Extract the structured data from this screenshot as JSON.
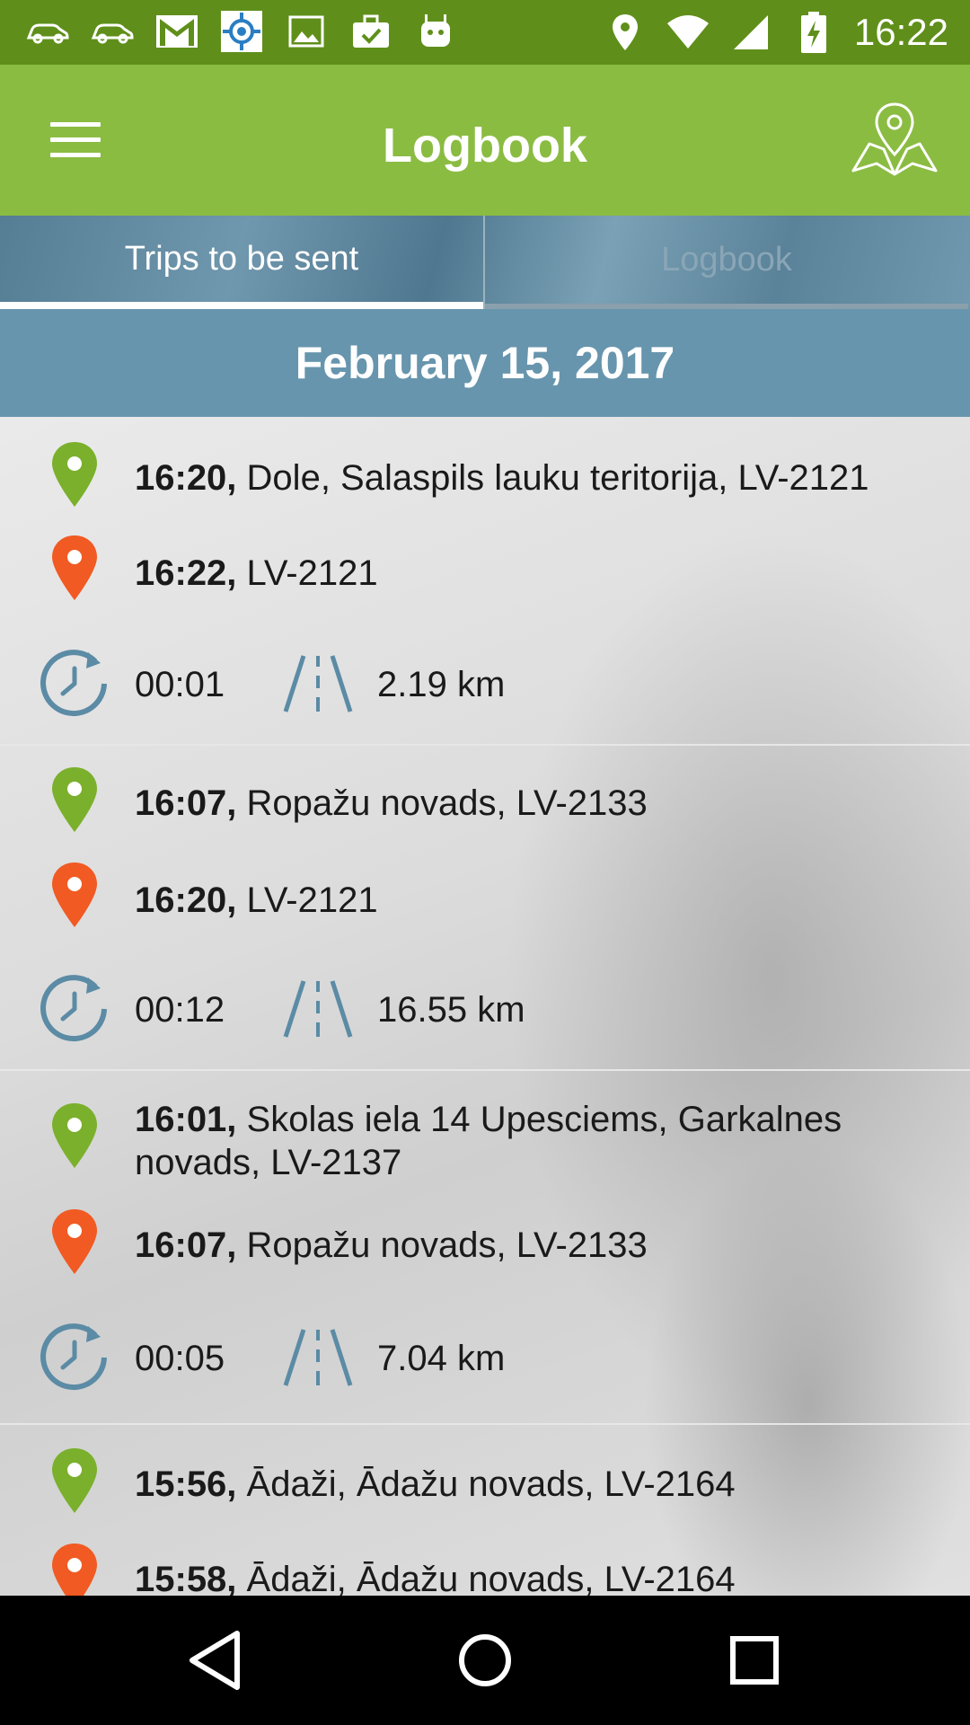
{
  "status_bar": {
    "time": "16:22",
    "left_icons": [
      "car-icon",
      "car-icon",
      "gmail-icon",
      "location-target-icon",
      "image-icon",
      "briefcase-check-icon",
      "android-icon"
    ],
    "right_icons": [
      "location-pin-icon",
      "wifi-icon",
      "signal-icon",
      "battery-charging-icon"
    ]
  },
  "app_bar": {
    "title": "Logbook",
    "menu_icon": "hamburger-menu-icon",
    "map_icon": "map-pin-icon"
  },
  "tabs": [
    {
      "label": "Trips to be sent",
      "active": true
    },
    {
      "label": "Logbook",
      "active": false
    }
  ],
  "date_header": "February 15, 2017",
  "trips": [
    {
      "start": {
        "time": "16:20,",
        "place": "Dole, Salaspils lauku teritorija, LV-2121"
      },
      "end": {
        "time": "16:22,",
        "place": "LV-2121"
      },
      "duration": "00:01",
      "distance": "2.19 km"
    },
    {
      "start": {
        "time": "16:07,",
        "place": "Ropažu novads, LV-2133"
      },
      "end": {
        "time": "16:20,",
        "place": "LV-2121"
      },
      "duration": "00:12",
      "distance": "16.55 km"
    },
    {
      "start": {
        "time": "16:01,",
        "place": "Skolas iela 14 Upesciems, Garkalnes novads, LV-2137"
      },
      "end": {
        "time": "16:07,",
        "place": "Ropažu novads, LV-2133"
      },
      "duration": "00:05",
      "distance": "7.04 km"
    },
    {
      "start": {
        "time": "15:56,",
        "place": "Ādaži, Ādažu novads, LV-2164"
      },
      "end": {
        "time": "15:58,",
        "place": "Ādaži, Ādažu novads, LV-2164"
      }
    }
  ],
  "colors": {
    "status_bar": "#5f8f1a",
    "app_bar": "#8bbc42",
    "date_header": "#6795ad",
    "start_pin": "#7ab02c",
    "end_pin": "#f15a22",
    "icon_blue": "#5b8ba5"
  },
  "nav_bar": [
    "back-icon",
    "home-icon",
    "recents-icon"
  ]
}
